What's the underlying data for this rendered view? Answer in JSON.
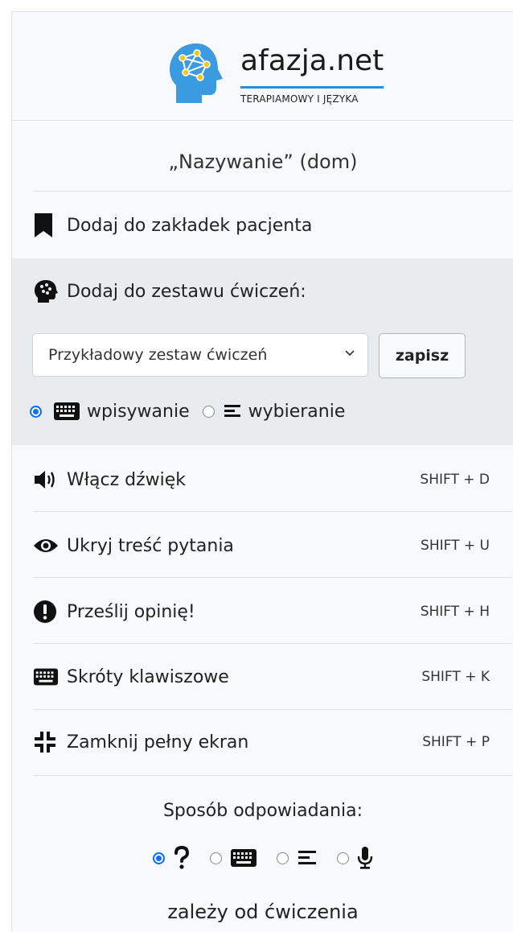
{
  "logo": {
    "name": "afazja.net",
    "tagline": "TERAPIAMOWY I JĘZYKA"
  },
  "exercise_title": "„Nazywanie” (dom)",
  "bookmark": {
    "label": "Dodaj do zakładek pacjenta"
  },
  "exercise_set": {
    "label": "Dodaj do zestawu ćwiczeń:",
    "selected": "Przykładowy zestaw ćwiczeń",
    "save_label": "zapisz",
    "modes": [
      {
        "label": "wpisywanie",
        "checked": true
      },
      {
        "label": "wybieranie",
        "checked": false
      }
    ]
  },
  "actions": [
    {
      "label": "Włącz dźwięk",
      "shortcut": "SHIFT + D"
    },
    {
      "label": "Ukryj treść pytania",
      "shortcut": "SHIFT + U"
    },
    {
      "label": "Prześlij opinię!",
      "shortcut": "SHIFT + H"
    },
    {
      "label": "Skróty klawiszowe",
      "shortcut": "SHIFT + K"
    },
    {
      "label": "Zamknij pełny ekran",
      "shortcut": "SHIFT + P"
    }
  ],
  "answer_mode": {
    "title": "Sposób odpowiadania:",
    "options": [
      {
        "icon": "question-icon",
        "checked": true
      },
      {
        "icon": "keyboard-icon",
        "checked": false
      },
      {
        "icon": "list-icon",
        "checked": false
      },
      {
        "icon": "microphone-icon",
        "checked": false
      }
    ],
    "note": "zależy od ćwiczenia"
  },
  "colors": {
    "accent": "#0d6efd",
    "logo_blue": "#2d8cd6",
    "panel_bg": "#f8f9fa",
    "set_bg": "#e9ecef"
  }
}
